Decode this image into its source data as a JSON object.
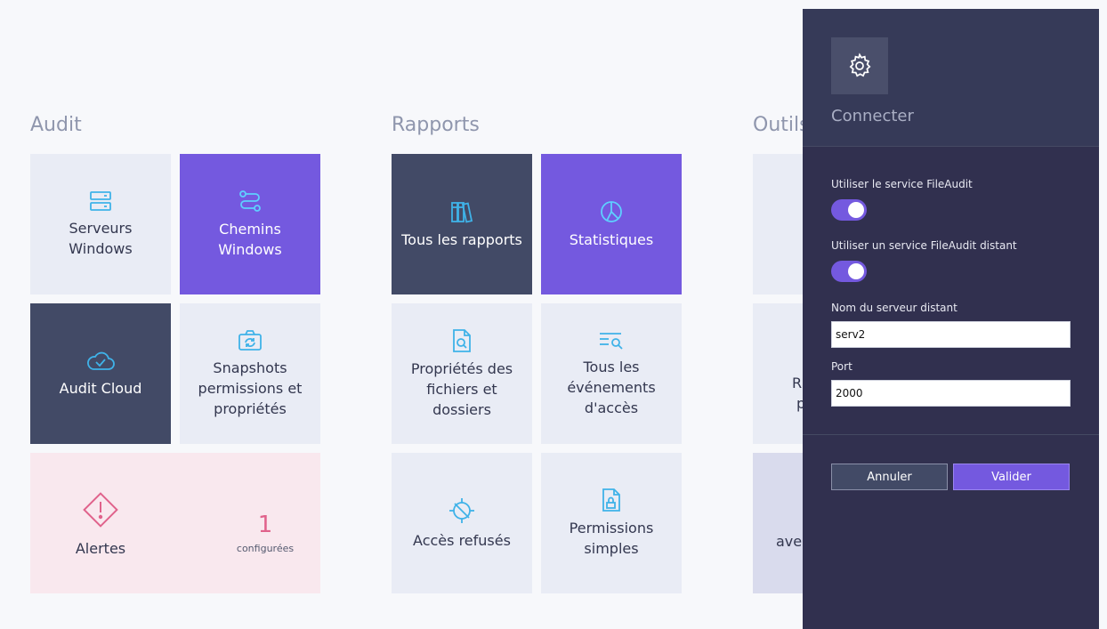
{
  "sections": {
    "audit": "Audit",
    "rapports": "Rapports",
    "outils": "Outils"
  },
  "tiles": {
    "serveurs_l1": "Serveurs",
    "serveurs_l2": "Windows",
    "chemins_l1": "Chemins",
    "chemins_l2": "Windows",
    "audit_cloud": "Audit Cloud",
    "snapshots_l1": "Snapshots",
    "snapshots_l2": "permissions et",
    "snapshots_l3": "propriétés",
    "tous_rapports": "Tous les rapports",
    "statistiques": "Statistiques",
    "proprietes_l1": "Propriétés des",
    "proprietes_l2": "fichiers et",
    "proprietes_l3": "dossiers",
    "evenements_l1": "Tous les",
    "evenements_l2": "événements",
    "evenements_l3": "d'accès",
    "acces_refuses": "Accès refusés",
    "permissions_l1": "Permissions",
    "permissions_l2": "simples",
    "alertes": "Alertes",
    "alertes_count": "1",
    "alertes_sub": "configurées",
    "outils_partial_1": "R",
    "outils_partial_2": "p",
    "outils_partial_3": "aver"
  },
  "panel": {
    "title": "Connecter",
    "label_service": "Utiliser le service FileAudit",
    "label_distant": "Utiliser un service FileAudit distant",
    "label_server": "Nom du serveur distant",
    "server_value": "serv2",
    "label_port": "Port",
    "port_value": "2000",
    "cancel": "Annuler",
    "ok": "Valider",
    "toggle_service_on": true,
    "toggle_distant_on": true
  },
  "colors": {
    "accent": "#7459df",
    "dark_tile": "#424a66",
    "light_tile": "#e9ecf5",
    "icon_blue": "#3fb2e8",
    "alert_pink": "#e0628b",
    "panel_bg": "#31304f"
  }
}
